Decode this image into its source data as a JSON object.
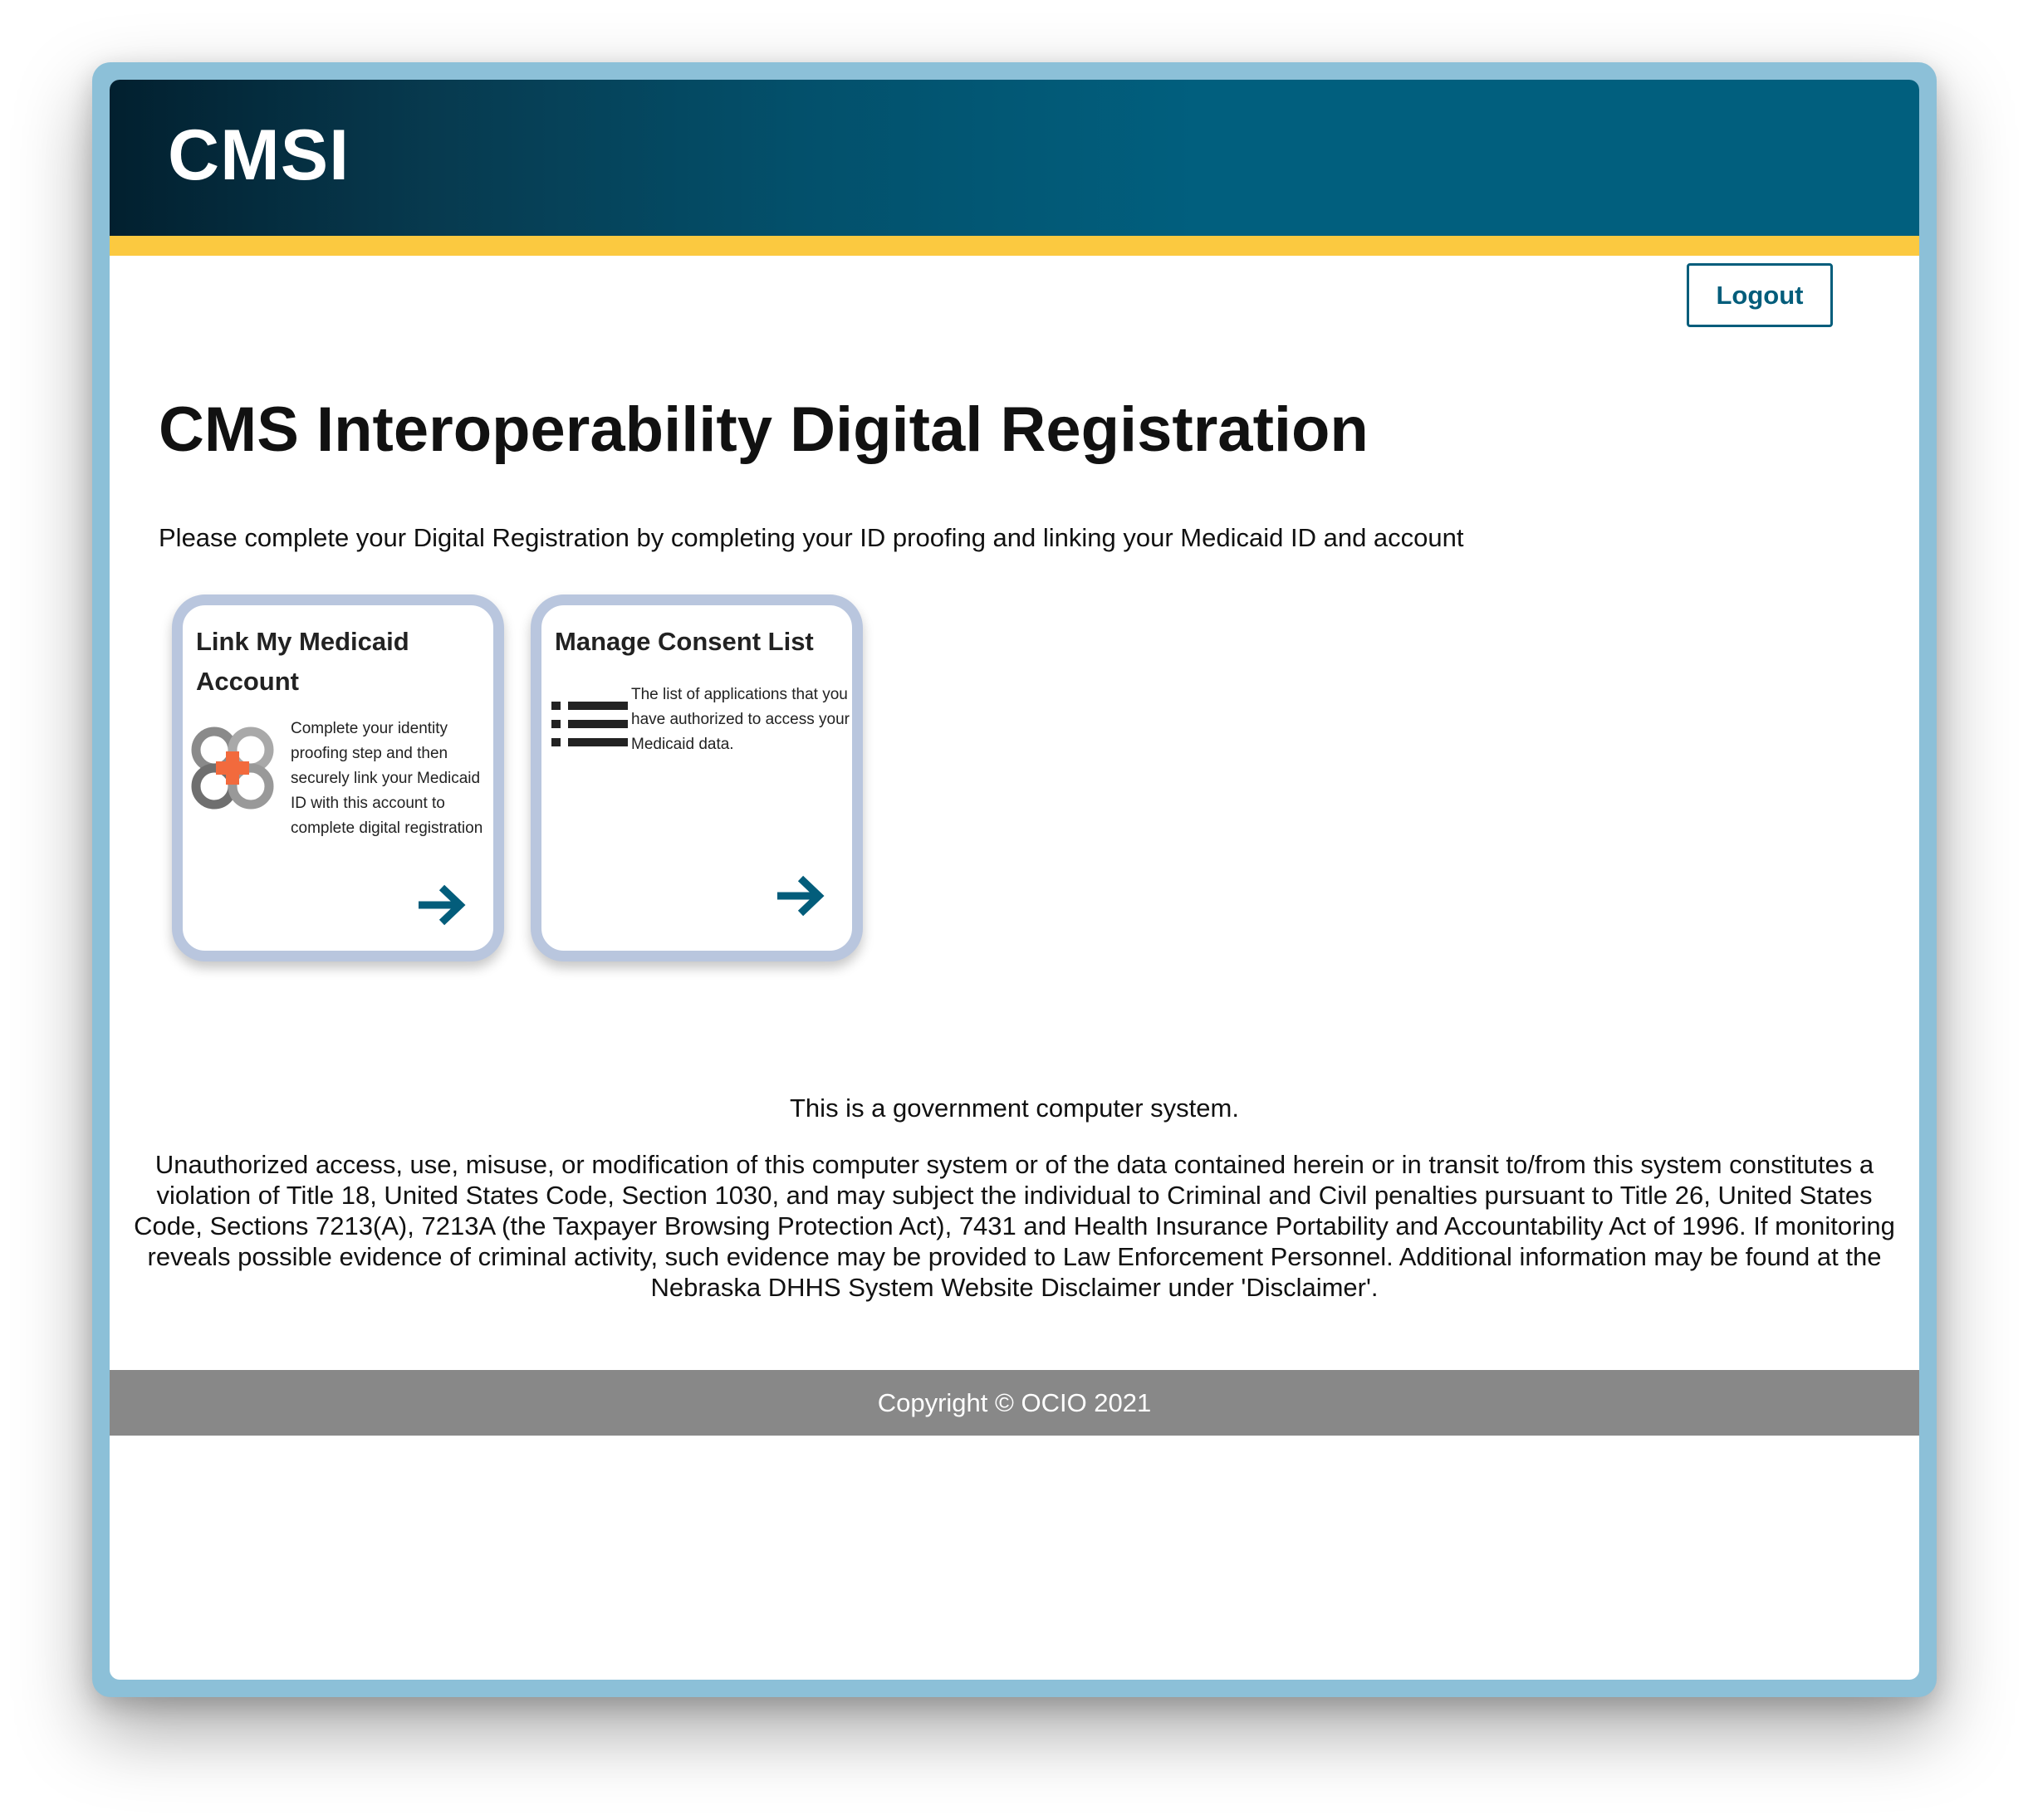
{
  "header": {
    "app_title": "CMSI",
    "logout_label": "Logout"
  },
  "main": {
    "page_title": "CMS Interoperability Digital Registration",
    "intro": "Please complete your Digital Registration by completing your ID proofing and linking your Medicaid ID and account",
    "cards": [
      {
        "title": "Link My Medicaid Account",
        "description": "Complete your identity proofing step and then securely link your Medicaid ID with this account to complete digital registration",
        "icon": "medicaid-link-icon",
        "arrow_icon": "arrow-right-icon"
      },
      {
        "title": "Manage Consent List",
        "description": "The list of applications that you have authorized to access your Medicaid data.",
        "icon": "list-icon",
        "arrow_icon": "arrow-right-icon"
      }
    ]
  },
  "disclaimer": {
    "heading": "This is a government computer system.",
    "body": "Unauthorized access, use, misuse, or modification of this computer system or of the data contained herein or in transit to/from this system constitutes a violation of Title 18, United States Code, Section 1030, and may subject the individual to Criminal and Civil penalties pursuant to Title 26, United States Code, Sections 7213(A), 7213A (the Taxpayer Browsing Protection Act), 7431 and Health Insurance Portability and Accountability Act of 1996. If monitoring reveals possible evidence of criminal activity, such evidence may be provided to Law Enforcement Personnel. Additional information may be found at the Nebraska DHHS System Website Disclaimer under 'Disclaimer'."
  },
  "footer": {
    "copyright": "Copyright © OCIO 2021"
  },
  "colors": {
    "header_dark": "#02202f",
    "header_blue": "#015f7e",
    "accent_yellow": "#fbc940",
    "primary": "#035d7b",
    "card_border": "#b9c6de",
    "footer_gray": "#888888",
    "icon_orange": "#f26a3d"
  }
}
